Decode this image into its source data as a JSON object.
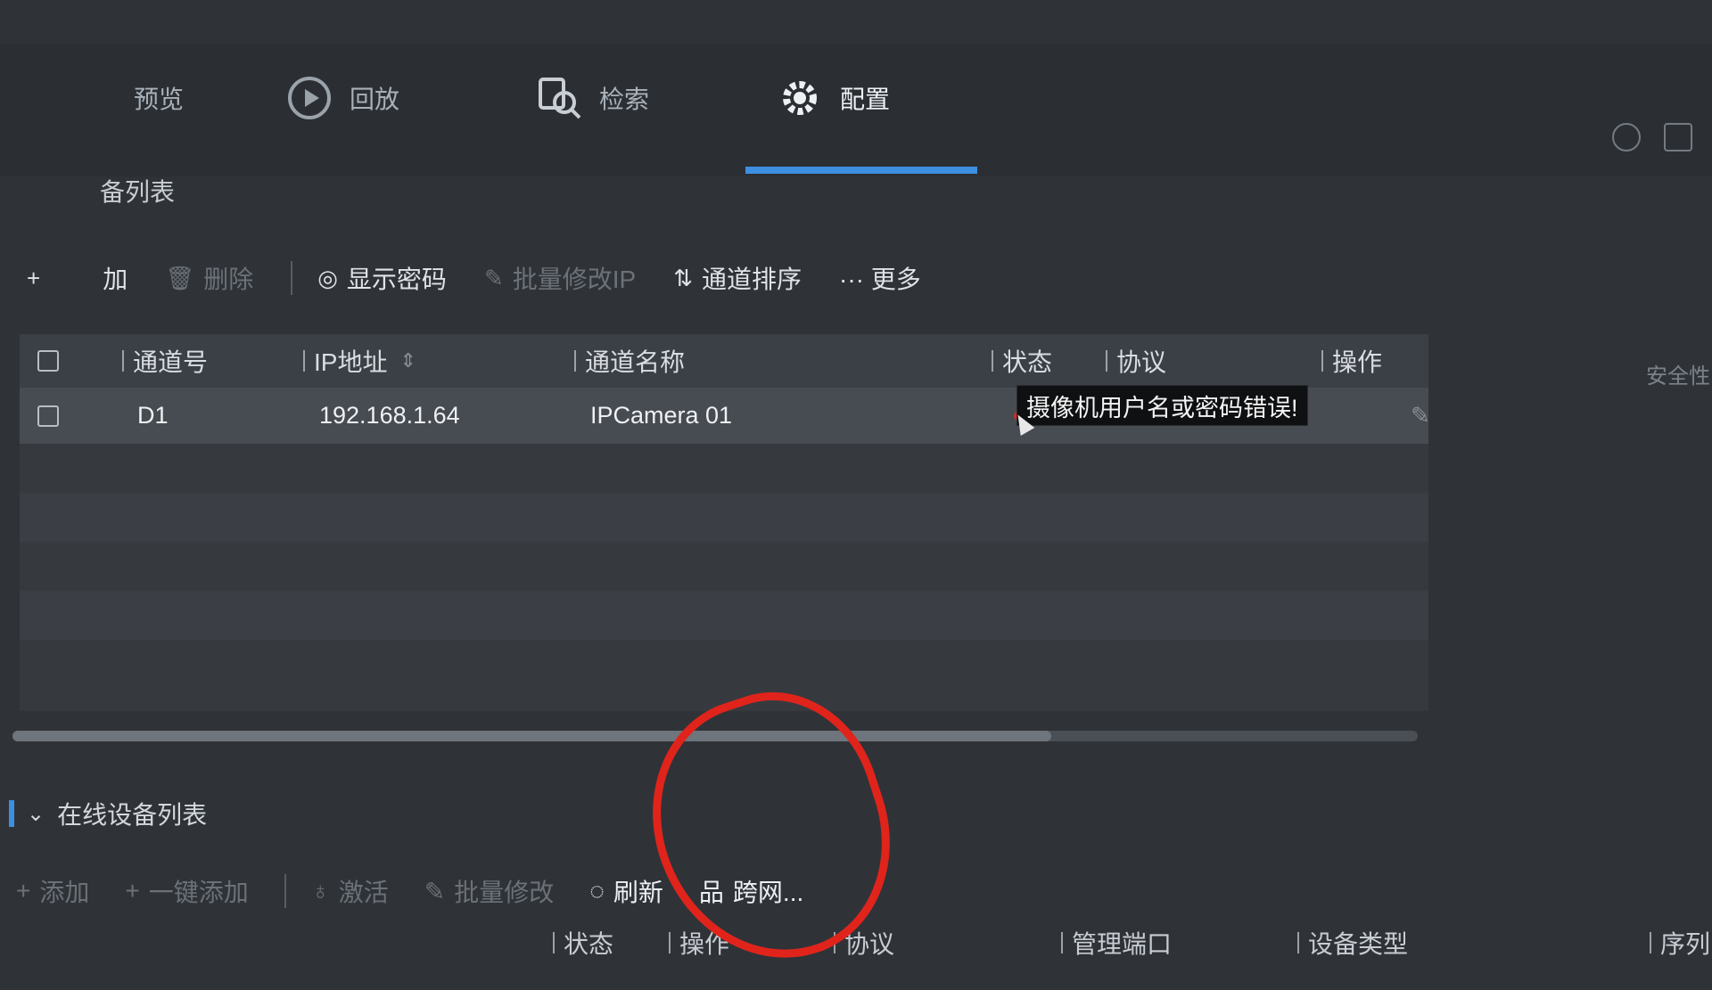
{
  "nav": {
    "items": [
      {
        "label": "预览",
        "icon": "preview-icon"
      },
      {
        "label": "回放",
        "icon": "playback-icon"
      },
      {
        "label": "检索",
        "icon": "search-icon"
      },
      {
        "label": "配置",
        "icon": "gear-icon",
        "active": true
      }
    ]
  },
  "section": {
    "title": "备列表"
  },
  "toolbar": {
    "add": "+",
    "add_text": "加",
    "delete": "删除",
    "show_password": "显示密码",
    "batch_modify_ip": "批量修改IP",
    "channel_sort": "通道排序",
    "more": "··· 更多"
  },
  "table": {
    "headers": {
      "channel_no": "通道号",
      "ip": "IP地址",
      "ip_sort": "⇕",
      "name": "通道名称",
      "status": "状态",
      "protocol": "协议",
      "action": "操作"
    },
    "rows": [
      {
        "channel_no": "D1",
        "ip": "192.168.1.64",
        "name": "IPCamera 01"
      }
    ]
  },
  "tooltip": {
    "text": "摄像机用户名或密码错误!"
  },
  "online": {
    "title": "在线设备列表",
    "toolbar": {
      "add": "添加",
      "one_click_add": "一键添加",
      "activate": "激活",
      "batch_modify": "批量修改",
      "refresh": "刷新",
      "cross_network": "跨网..."
    },
    "headers": {
      "status": "状态",
      "action": "操作",
      "protocol": "协议",
      "manage_port": "管理端口",
      "device_type": "设备类型",
      "serial": "序列"
    }
  },
  "side": {
    "security": "安全性"
  },
  "colors": {
    "accent": "#3d8fe0",
    "annotation": "#e0241b"
  }
}
